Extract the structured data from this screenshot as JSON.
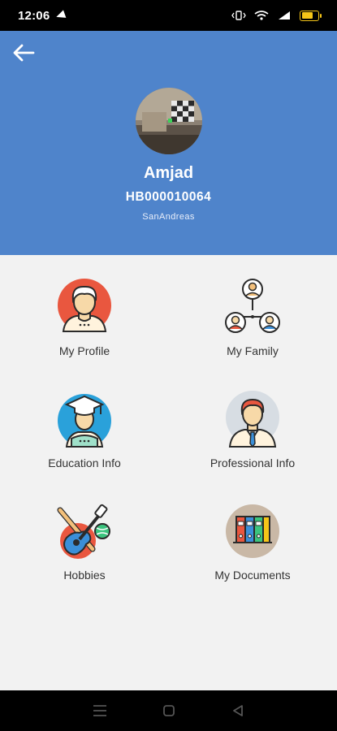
{
  "status_bar": {
    "time": "12:06"
  },
  "header": {
    "name": "Amjad",
    "member_id": "HB000010064",
    "city": "SanAndreas",
    "background": "#4f84cb"
  },
  "menu": [
    {
      "label": "My Profile",
      "icon": "profile-icon"
    },
    {
      "label": "My Family",
      "icon": "family-icon"
    },
    {
      "label": "Education Info",
      "icon": "graduate-icon"
    },
    {
      "label": "Professional Info",
      "icon": "professional-icon"
    },
    {
      "label": "Hobbies",
      "icon": "guitar-icon"
    },
    {
      "label": "My Documents",
      "icon": "binders-icon"
    }
  ]
}
